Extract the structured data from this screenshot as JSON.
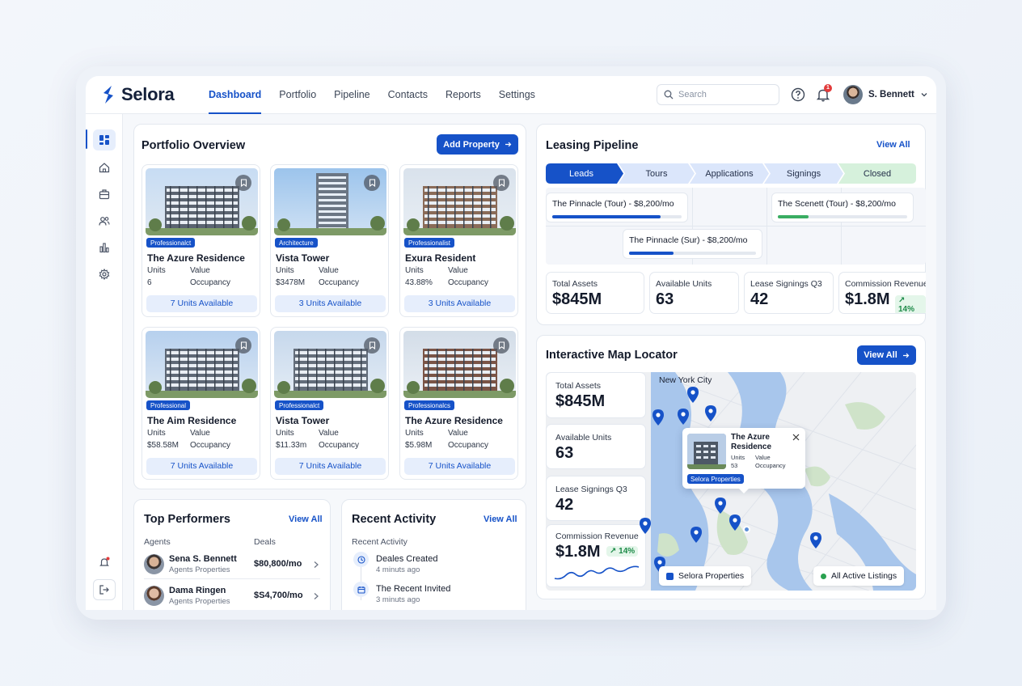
{
  "app": {
    "name": "Selora"
  },
  "nav": {
    "links": [
      "Dashboard",
      "Portfolio",
      "Pipeline",
      "Contacts",
      "Reports",
      "Settings"
    ],
    "active": "Dashboard"
  },
  "search": {
    "placeholder": "Search"
  },
  "notifications": {
    "count": "1"
  },
  "user": {
    "name": "S. Bennett"
  },
  "portfolio": {
    "title": "Portfolio Overview",
    "add_label": "Add Property",
    "properties": [
      {
        "tag": "Professionalct",
        "name": "The Azure Residence",
        "l1a": "Units",
        "l1b": "Value",
        "l2a": "6",
        "l2b": "Occupancy",
        "cta": "7 Units Available"
      },
      {
        "tag": "Architecture",
        "name": "Vista Tower",
        "l1a": "Units",
        "l1b": "Value",
        "l2a": "$3478M",
        "l2b": "Occupancy",
        "cta": "3 Units Available"
      },
      {
        "tag": "Professionalist",
        "name": "Exura Resident",
        "l1a": "Units",
        "l1b": "Value",
        "l2a": "43.88%",
        "l2b": "Occupancy",
        "cta": "3 Units Available"
      },
      {
        "tag": "Professional",
        "name": "The Aim Residence",
        "l1a": "Units",
        "l1b": "Value",
        "l2a": "$58.58M",
        "l2b": "Occupancy",
        "cta": "7 Units Available"
      },
      {
        "tag": "Professionalct",
        "name": "Vista Tower",
        "l1a": "Units",
        "l1b": "Value",
        "l2a": "$11.33m",
        "l2b": "Occupancy",
        "cta": "7 Units Available"
      },
      {
        "tag": "Professionalcs",
        "name": "The Azure Residence",
        "l1a": "Units",
        "l1b": "Value",
        "l2a": "$5.98M",
        "l2b": "Occupancy",
        "cta": "7 Units Available"
      }
    ]
  },
  "pipeline": {
    "title": "Leasing Pipeline",
    "view_all": "View All",
    "stages": [
      "Leads",
      "Tours",
      "Applications",
      "Signings",
      "Closed"
    ],
    "deals": [
      {
        "title": "The Pinnacle (Tour) - $8,200/mo",
        "progress": 0.84
      },
      {
        "title": "The Pinnacle (Sur) - $8,200/mo",
        "progress": 0.35
      },
      {
        "title": "The Scenett (Tour) - $8,200/mo",
        "progress": 0.24
      }
    ],
    "stats": [
      {
        "label": "Total Assets",
        "value": "$845M"
      },
      {
        "label": "Available Units",
        "value": "63"
      },
      {
        "label": "Lease Signings Q3",
        "value": "42"
      },
      {
        "label": "Commission Revenue",
        "value": "$1.8M",
        "delta": "↗ 14%"
      }
    ]
  },
  "map": {
    "title": "Interactive Map Locator",
    "view_all": "View All",
    "city": "New York City",
    "stats": [
      {
        "label": "Total Assets",
        "value": "$845M"
      },
      {
        "label": "Available Units",
        "value": "63"
      },
      {
        "label": "Lease Signings Q3",
        "value": "42"
      },
      {
        "label": "Commission Revenue",
        "value": "$1.8M",
        "delta": "↗ 14%"
      }
    ],
    "popup": {
      "name": "The Azure Residence",
      "l1a": "Units",
      "l1b": "Value",
      "l2a": "53",
      "l2b": "Occupancy",
      "tag": "Selora Properties"
    },
    "legend_left": "Selora Properties",
    "legend_right": "All Active Listings",
    "pin_color": "#1652c8"
  },
  "performers": {
    "title": "Top Performers",
    "view_all": "View All",
    "col_agents": "Agents",
    "col_deals": "Deals",
    "rows": [
      {
        "name": "Sena S. Bennett",
        "sub": "Agents Properties",
        "value": "$80,800/mo"
      },
      {
        "name": "Dama Ringen",
        "sub": "Agents Properties",
        "value": "$S4,700/mo"
      }
    ]
  },
  "activity": {
    "title": "Recent Activity",
    "view_all": "View All",
    "subtitle": "Recent Activity",
    "items": [
      {
        "title": "Deales Created",
        "time": "4 minuts ago"
      },
      {
        "title": "The Recent Invited",
        "time": "3 minuts ago"
      }
    ]
  },
  "colors": {
    "accent": "#1652c8",
    "success": "#1d8a48",
    "closed_stage": "#d6f1dc"
  }
}
